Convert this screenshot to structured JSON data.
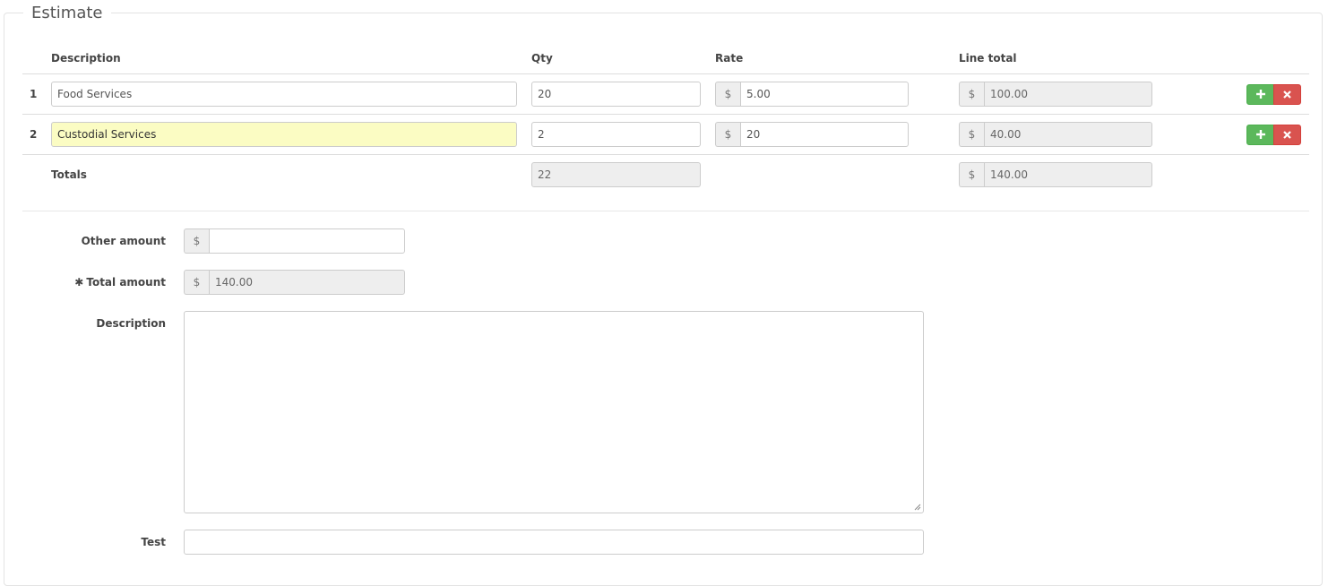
{
  "legend": "Estimate",
  "table": {
    "headers": {
      "description": "Description",
      "qty": "Qty",
      "rate": "Rate",
      "line_total": "Line total"
    },
    "currency_symbol": "$",
    "rows": [
      {
        "num": "1",
        "description": "Food Services",
        "qty": "20",
        "rate": "5.00",
        "line_total": "100.00",
        "add_icon": "plus-icon",
        "remove_icon": "times-icon"
      },
      {
        "num": "2",
        "description": "Custodial Services",
        "qty": "2",
        "rate": "20",
        "line_total": "40.00",
        "add_icon": "plus-icon",
        "remove_icon": "times-icon"
      }
    ],
    "totals": {
      "label": "Totals",
      "qty": "22",
      "line_total": "140.00"
    }
  },
  "form": {
    "other_amount": {
      "label": "Other amount",
      "value": ""
    },
    "total_amount": {
      "required_mark": "✱",
      "label": "Total amount",
      "value": "140.00"
    },
    "description": {
      "label": "Description",
      "value": ""
    },
    "test": {
      "label": "Test",
      "value": ""
    }
  },
  "colors": {
    "add_button": "#5cb85c",
    "remove_button": "#d9534f",
    "highlight_field": "#fbfcc3"
  }
}
